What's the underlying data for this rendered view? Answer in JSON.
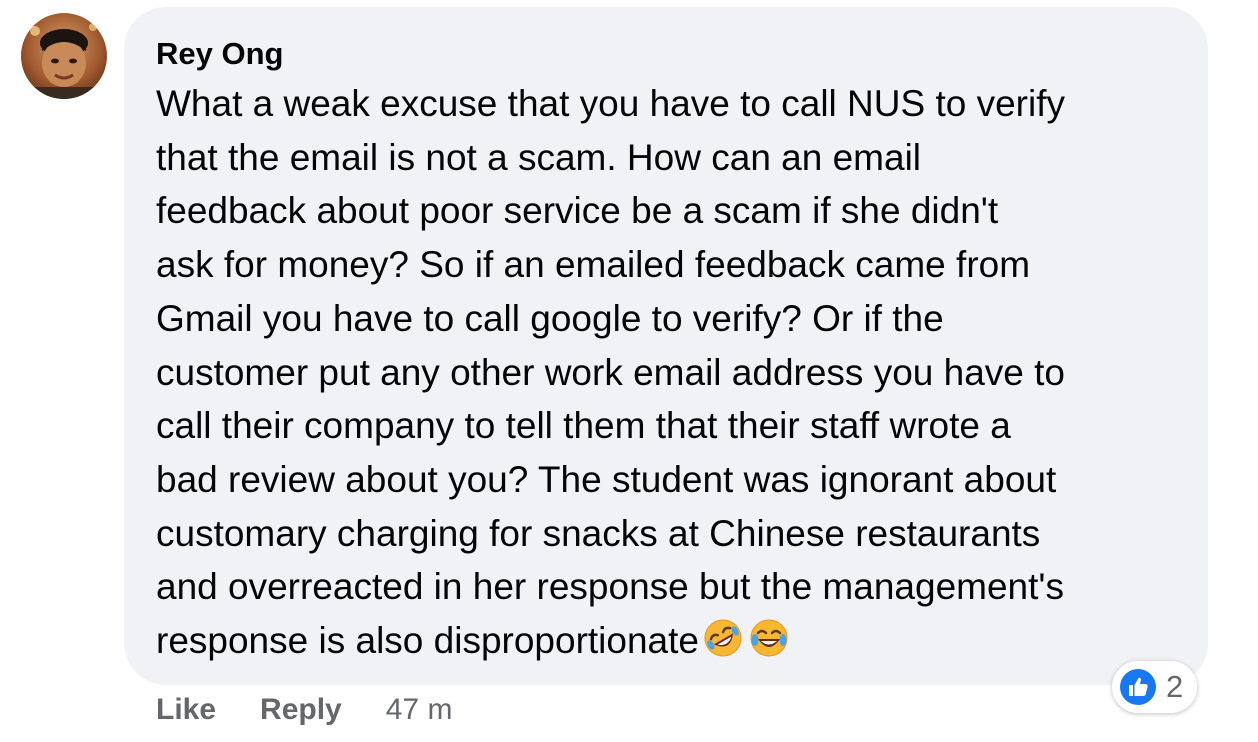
{
  "comment": {
    "author": "Rey Ong",
    "avatar_icon": "user-avatar",
    "text_lines": [
      "What a weak excuse that you have to call NUS to verify",
      "that the email is not a scam. How can an email",
      "feedback about poor service be a scam if she didn't",
      "ask for money? So if an emailed feedback came from",
      "Gmail you have to call google to verify? Or if the",
      "customer put any other work email address you have to",
      "call their company to tell them that their staff wrote a",
      "bad review about you? The student was ignorant about",
      "customary charging for snacks at Chinese restaurants",
      "and overreacted in her response but the management's",
      "response is also disproportionate"
    ],
    "emojis": [
      "rolling-on-floor-laughing-emoji",
      "face-with-tears-of-joy-emoji"
    ]
  },
  "reactions": {
    "icon": "thumbs-up-icon",
    "count": "2",
    "color": "#1877f2"
  },
  "actions": {
    "like_label": "Like",
    "reply_label": "Reply",
    "timestamp": "47 m"
  },
  "colors": {
    "bubble": "#f0f2f5",
    "text": "#050505",
    "secondary": "#65676b"
  }
}
